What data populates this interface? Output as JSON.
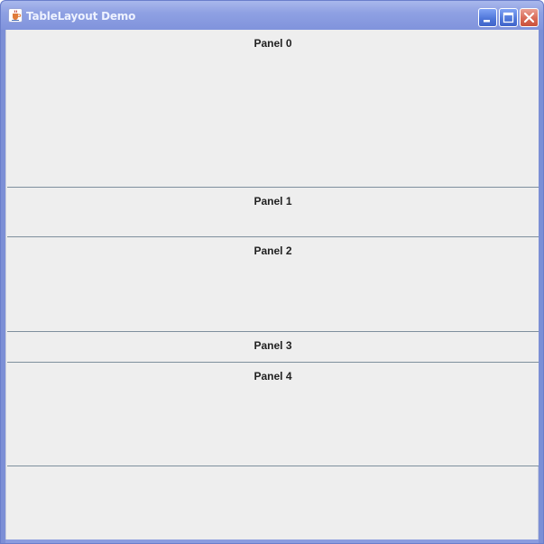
{
  "window": {
    "title": "TableLayout Demo",
    "icon": "java-cup-icon",
    "controls": {
      "minimize": "minimize-icon",
      "maximize": "maximize-icon",
      "close": "close-icon"
    }
  },
  "panels": [
    {
      "label": "Panel 0"
    },
    {
      "label": "Panel 1"
    },
    {
      "label": "Panel 2"
    },
    {
      "label": "Panel 3"
    },
    {
      "label": "Panel 4"
    }
  ],
  "colors": {
    "titlebar": "#8fa1e3",
    "panel_background": "#eeeeee",
    "panel_border": "#7e8f9d",
    "close_button": "#d96b57"
  }
}
